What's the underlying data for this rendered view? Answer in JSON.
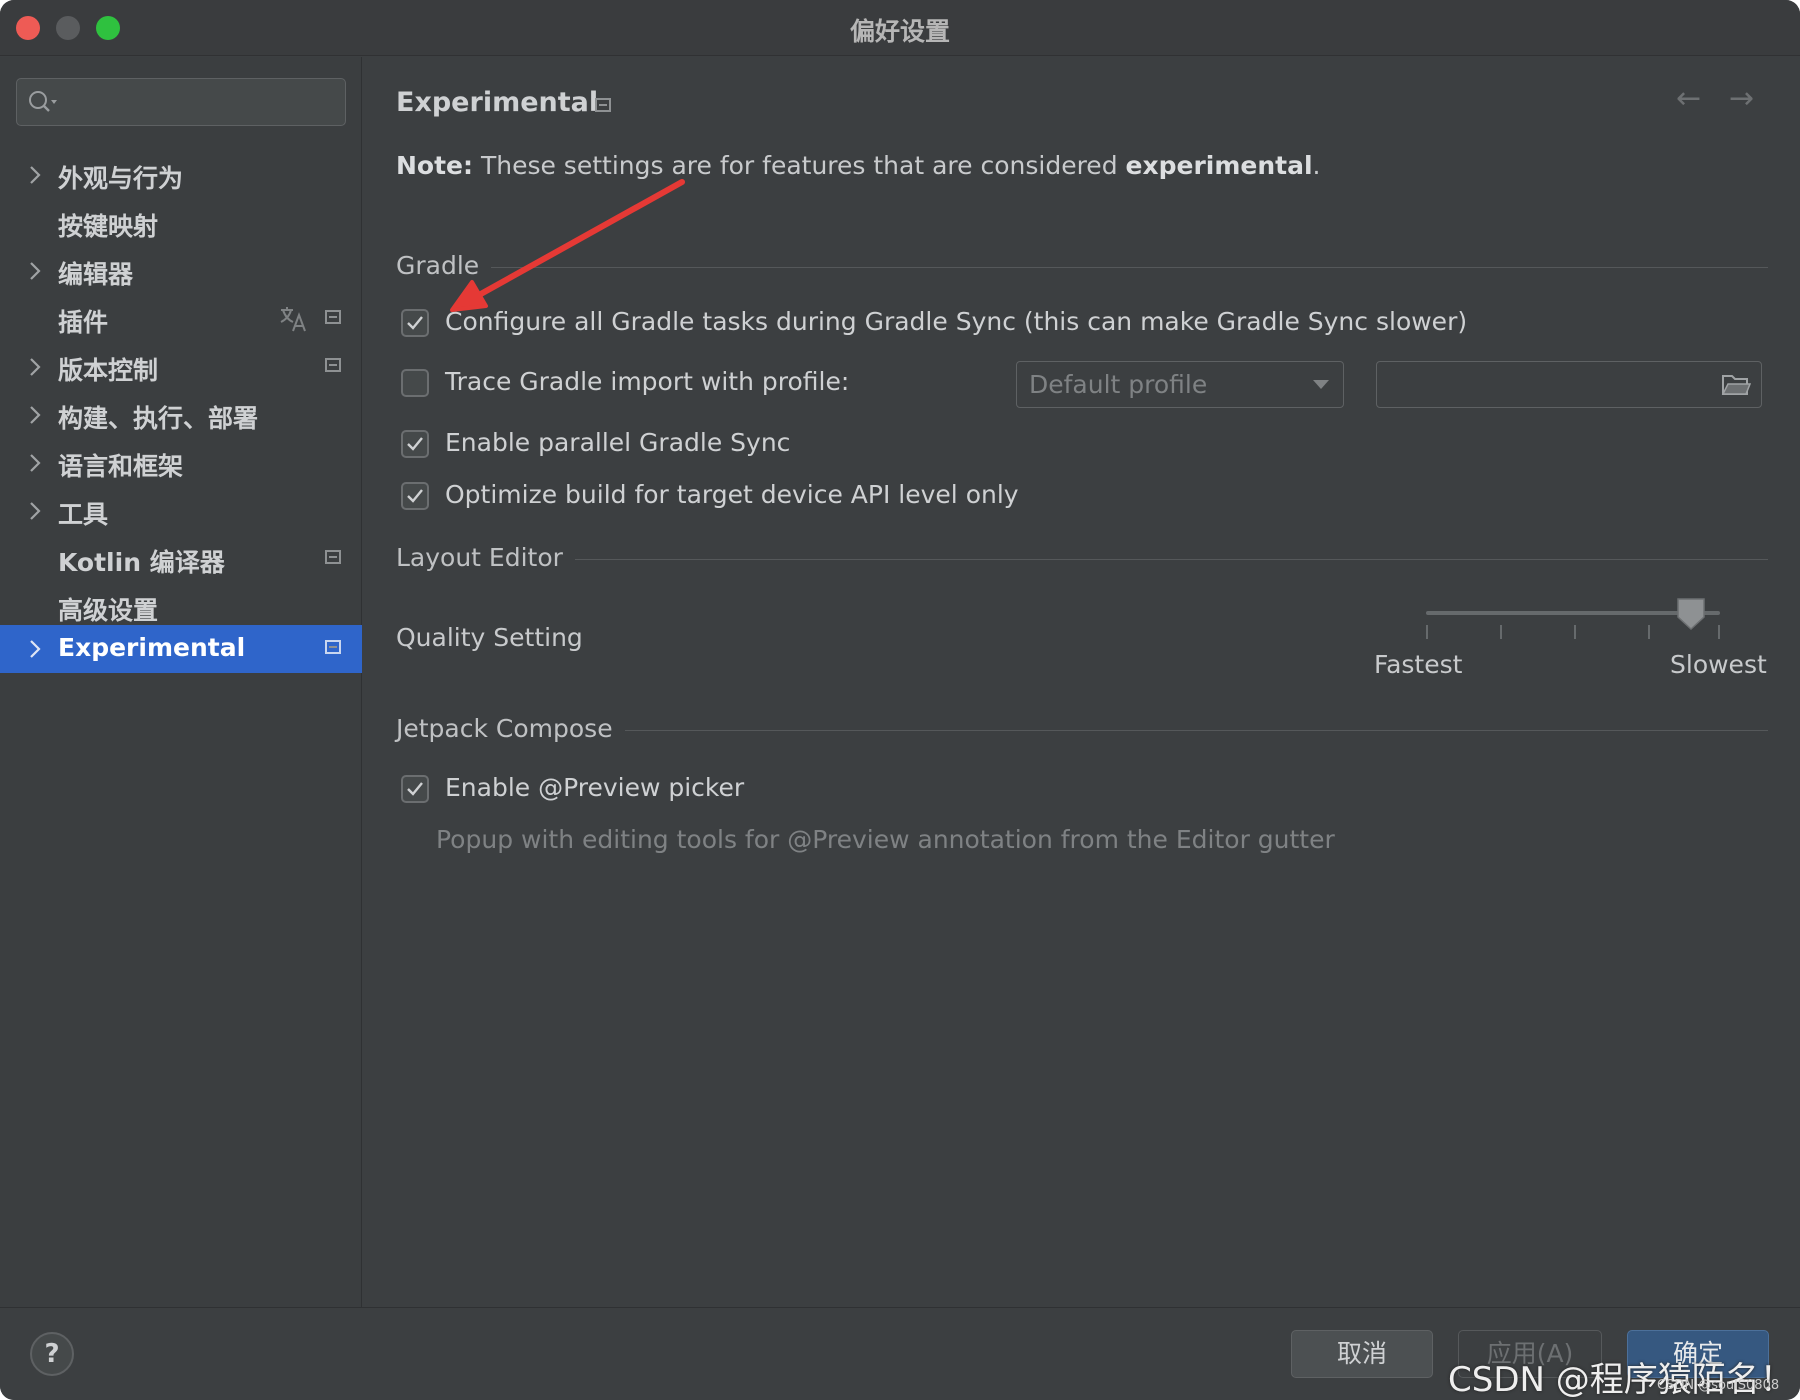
{
  "window": {
    "title": "偏好设置"
  },
  "sidebar": {
    "search": {
      "value": "",
      "placeholder": ""
    },
    "items": [
      {
        "label": "外观与行为",
        "expandable": true,
        "selected": false
      },
      {
        "label": "按键映射",
        "expandable": false,
        "selected": false
      },
      {
        "label": "编辑器",
        "expandable": true,
        "selected": false
      },
      {
        "label": "插件",
        "expandable": false,
        "selected": false
      },
      {
        "label": "版本控制",
        "expandable": true,
        "selected": false
      },
      {
        "label": "构建、执行、部署",
        "expandable": true,
        "selected": false
      },
      {
        "label": "语言和框架",
        "expandable": true,
        "selected": false
      },
      {
        "label": "工具",
        "expandable": true,
        "selected": false
      },
      {
        "label": "Kotlin 编译器",
        "expandable": false,
        "selected": false
      },
      {
        "label": "高级设置",
        "expandable": false,
        "selected": false
      },
      {
        "label": "Experimental",
        "expandable": true,
        "selected": true
      }
    ]
  },
  "content": {
    "title": "Experimental",
    "note": {
      "prefix": "Note:",
      "text": " These settings are for features that are considered ",
      "emphasis": "experimental",
      "suffix": "."
    },
    "sections": {
      "gradle": "Gradle",
      "layout_editor": "Layout Editor",
      "jetpack_compose": "Jetpack Compose"
    },
    "gradle_options": [
      {
        "label": "Configure all Gradle tasks during Gradle Sync (this can make Gradle Sync slower)",
        "checked": true
      },
      {
        "label": "Trace Gradle import with profile:",
        "checked": false
      },
      {
        "label": "Enable parallel Gradle Sync",
        "checked": true
      },
      {
        "label": "Optimize build for target device API level only",
        "checked": true
      }
    ],
    "profile_combo": {
      "value": "Default profile"
    },
    "profile_path": {
      "value": ""
    },
    "quality": {
      "label": "Quality Setting",
      "min_label": "Fastest",
      "max_label": "Slowest",
      "level": 0.9
    },
    "compose_options": [
      {
        "label": "Enable @Preview picker",
        "checked": true
      }
    ],
    "compose_hint": "Popup with editing tools for @Preview annotation from the Editor gutter"
  },
  "footer": {
    "cancel_label": "取消",
    "apply_label": "应用(A)",
    "ok_label": "确定",
    "watermark": "CSDN @程序猿陌名！",
    "watermark_small": "CSDN @soulS0808"
  },
  "colors": {
    "selected_bg": "#2f65ca",
    "annotation_arrow": "#e53935",
    "ok_button": "#365880"
  },
  "icons": {
    "search": "search-icon",
    "expand": "chevron-right-icon",
    "project_scope": "project-scope-icon",
    "translate": "translate-icon",
    "back": "back-arrow-icon",
    "forward": "forward-arrow-icon",
    "folder": "folder-icon",
    "help": "help-icon"
  }
}
